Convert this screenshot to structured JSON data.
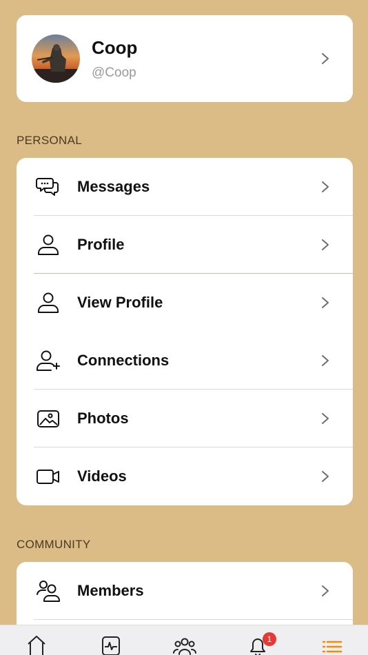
{
  "profile": {
    "name": "Coop",
    "handle": "@Coop"
  },
  "sections": {
    "personal": {
      "title": "PERSONAL",
      "items": [
        {
          "label": "Messages",
          "icon": "chat-bubbles-icon"
        },
        {
          "label": "Profile",
          "icon": "user-icon"
        },
        {
          "label": "View Profile",
          "icon": "user-icon"
        },
        {
          "label": "Connections",
          "icon": "user-plus-icon"
        },
        {
          "label": "Photos",
          "icon": "image-icon"
        },
        {
          "label": "Videos",
          "icon": "video-camera-icon"
        }
      ]
    },
    "community": {
      "title": "COMMUNITY",
      "items": [
        {
          "label": "Members",
          "icon": "users-group-icon"
        }
      ]
    }
  },
  "tabbar": {
    "tabs": [
      {
        "icon": "home-icon"
      },
      {
        "icon": "activity-icon"
      },
      {
        "icon": "groups-icon"
      },
      {
        "icon": "bell-icon"
      },
      {
        "icon": "menu-list-icon"
      }
    ],
    "notification_count": "1",
    "active_tab": "menu-list-icon",
    "active_color": "#f28c00"
  },
  "colors": {
    "background": "#dcbc86",
    "card": "#ffffff",
    "badge": "#e53935"
  }
}
